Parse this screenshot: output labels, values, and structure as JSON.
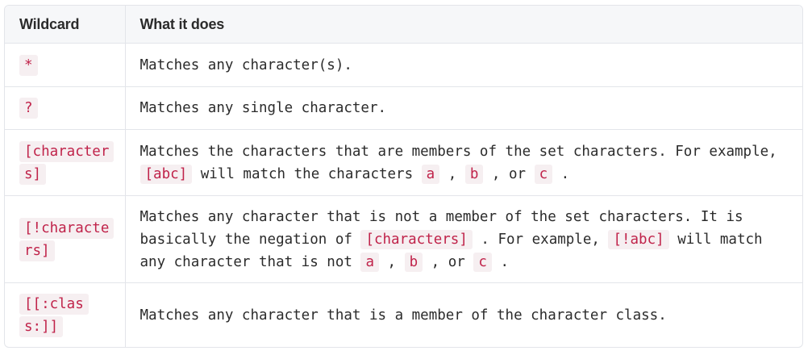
{
  "table": {
    "headers": {
      "wildcard": "Wildcard",
      "description": "What it does"
    },
    "rows": [
      {
        "wildcard": "*",
        "desc": [
          {
            "t": "Matches any character(s)."
          }
        ]
      },
      {
        "wildcard": "?",
        "desc": [
          {
            "t": "Matches any single character."
          }
        ]
      },
      {
        "wildcard": "[characters]",
        "desc": [
          {
            "t": "Matches the characters that are members of the set characters. For example, "
          },
          {
            "c": "[abc]"
          },
          {
            "t": " will match the characters "
          },
          {
            "c": "a"
          },
          {
            "t": " , "
          },
          {
            "c": "b"
          },
          {
            "t": " , or "
          },
          {
            "c": "c"
          },
          {
            "t": " ."
          }
        ]
      },
      {
        "wildcard": "[!characters]",
        "desc": [
          {
            "t": "Matches any character that is not a member of the set characters. It is basically the negation of "
          },
          {
            "c": "[characters]"
          },
          {
            "t": " . For example, "
          },
          {
            "c": "[!abc]"
          },
          {
            "t": " will match any character that is not "
          },
          {
            "c": "a"
          },
          {
            "t": " , "
          },
          {
            "c": "b"
          },
          {
            "t": " , or "
          },
          {
            "c": "c"
          },
          {
            "t": " ."
          }
        ]
      },
      {
        "wildcard": "[[:class:]]",
        "desc": [
          {
            "t": "Matches any character that is a member of the character class."
          }
        ]
      }
    ]
  }
}
